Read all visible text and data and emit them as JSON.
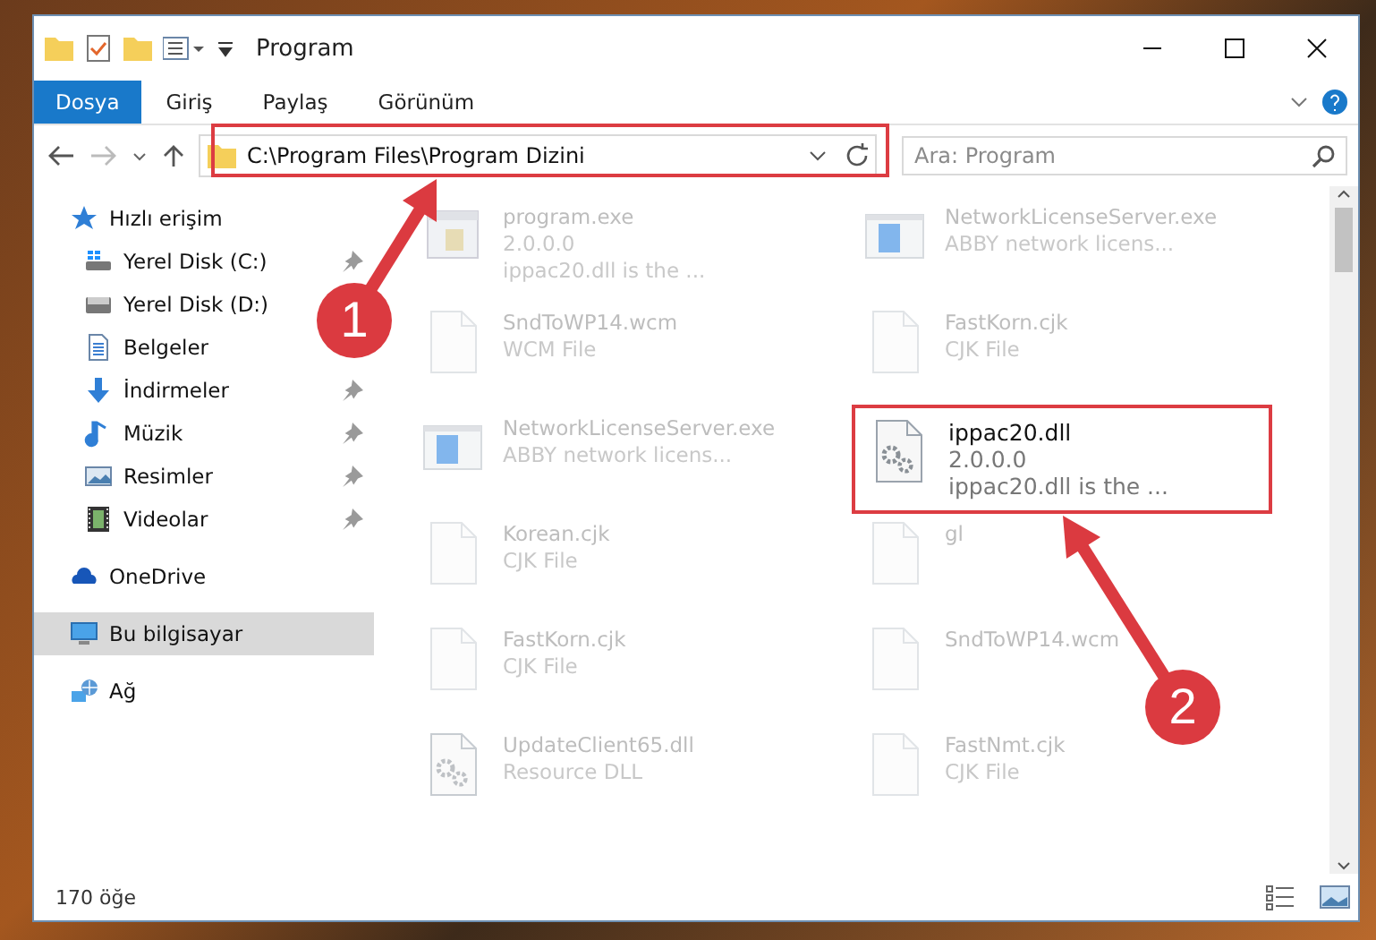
{
  "window": {
    "title": "Program"
  },
  "ribbon_tabs": [
    {
      "label": "Dosya",
      "selected": true
    },
    {
      "label": "Giriş",
      "selected": false
    },
    {
      "label": "Paylaş",
      "selected": false
    },
    {
      "label": "Görünüm",
      "selected": false
    }
  ],
  "address": {
    "path": "C:\\Program Files\\Program Dizini"
  },
  "search": {
    "placeholder": "Ara: Program"
  },
  "sidebar": {
    "items": [
      {
        "label": "Hızlı erişim",
        "kind": "star",
        "selected": false,
        "children": [
          {
            "label": "Yerel Disk (C:)",
            "kind": "drive-win",
            "pinned": true
          },
          {
            "label": "Yerel Disk (D:)",
            "kind": "drive",
            "pinned": false
          },
          {
            "label": "Belgeler",
            "kind": "document",
            "pinned": false
          },
          {
            "label": "İndirmeler",
            "kind": "download",
            "pinned": true
          },
          {
            "label": "Müzik",
            "kind": "music",
            "pinned": true
          },
          {
            "label": "Resimler",
            "kind": "pictures",
            "pinned": true
          },
          {
            "label": "Videolar",
            "kind": "video",
            "pinned": true
          }
        ]
      },
      {
        "label": "OneDrive",
        "kind": "cloud",
        "selected": false
      },
      {
        "label": "Bu bilgisayar",
        "kind": "computer",
        "selected": true
      },
      {
        "label": "Ağ",
        "kind": "network",
        "selected": false
      }
    ]
  },
  "files": [
    {
      "kind": "exe",
      "lines": [
        "program.exe",
        "2.0.0.0",
        "ippac20.dll is the ..."
      ],
      "highlighted": false
    },
    {
      "kind": "app",
      "lines": [
        "NetworkLicenseServer.exe",
        "ABBY network licens..."
      ],
      "highlighted": false
    },
    {
      "kind": "blank",
      "lines": [
        "SndToWP14.wcm",
        "WCM File"
      ],
      "highlighted": false
    },
    {
      "kind": "blank",
      "lines": [
        "FastKorn.cjk",
        "CJK File"
      ],
      "highlighted": false
    },
    {
      "kind": "app",
      "lines": [
        "NetworkLicenseServer.exe",
        "ABBY network licens..."
      ],
      "highlighted": false
    },
    {
      "kind": "dll",
      "lines": [
        "ippac20.dll",
        "2.0.0.0",
        "ippac20.dll is the ..."
      ],
      "highlighted": true
    },
    {
      "kind": "blank",
      "lines": [
        "Korean.cjk",
        "CJK File"
      ],
      "highlighted": false
    },
    {
      "kind": "blank",
      "lines": [
        "gl"
      ],
      "highlighted": false
    },
    {
      "kind": "blank",
      "lines": [
        "FastKorn.cjk",
        "CJK File"
      ],
      "highlighted": false
    },
    {
      "kind": "blank",
      "lines": [
        "SndToWP14.wcm"
      ],
      "highlighted": false
    },
    {
      "kind": "dll",
      "lines": [
        "UpdateClient65.dll",
        "Resource DLL"
      ],
      "highlighted": false
    },
    {
      "kind": "blank",
      "lines": [
        "FastNmt.cjk",
        "CJK File"
      ],
      "highlighted": false
    }
  ],
  "status_bar": {
    "count": "170 öğe"
  },
  "annotations": [
    {
      "label": "1"
    },
    {
      "label": "2"
    }
  ]
}
